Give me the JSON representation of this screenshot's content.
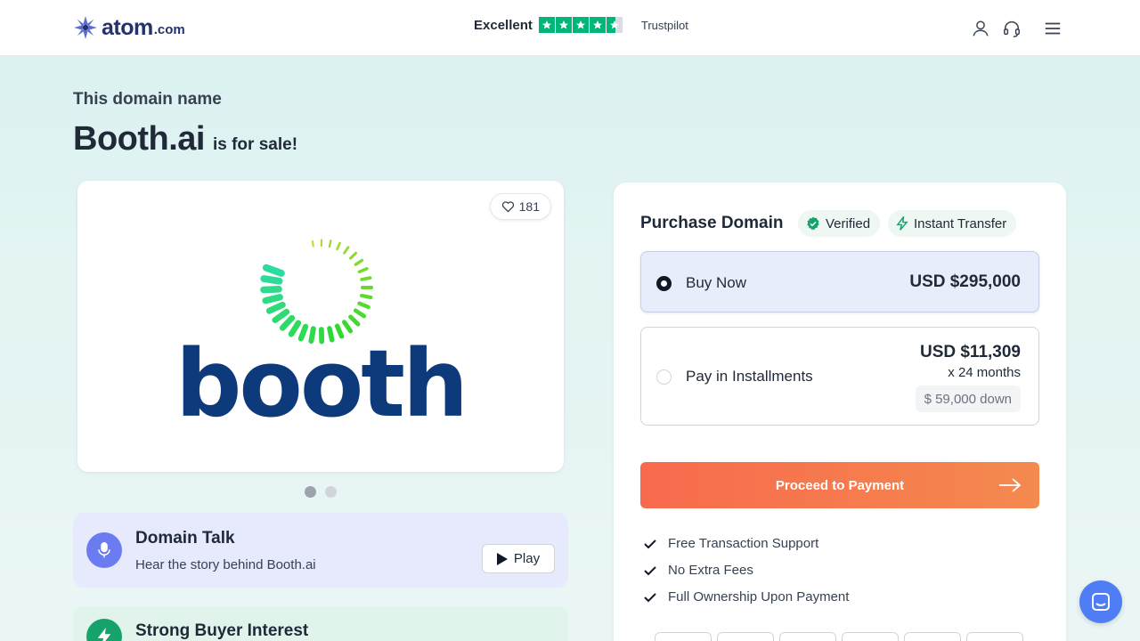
{
  "header": {
    "logo_word": "atom",
    "logo_tld": ".com",
    "trust_label": "Excellent",
    "trust_brand": "Trustpilot",
    "trust_rating_stars": 4.5,
    "icons": [
      "user-icon",
      "headset-icon",
      "menu-icon"
    ]
  },
  "hero": {
    "eyebrow": "This domain name",
    "domain": "Booth.ai",
    "for_sale": "is for sale!"
  },
  "logo_card": {
    "likes": "181",
    "logo_text": "booth",
    "slide_count": 2,
    "active_slide": 1
  },
  "domain_talk": {
    "title": "Domain Talk",
    "subtitle": "Hear the story behind Booth.ai",
    "play_label": "Play"
  },
  "interest": {
    "title": "Strong Buyer Interest"
  },
  "purchase": {
    "title": "Purchase Domain",
    "badge_verified": "Verified",
    "badge_transfer": "Instant Transfer",
    "buy_now_label": "Buy Now",
    "buy_now_price": "USD $295,000",
    "installments_label": "Pay in Installments",
    "installments_price": "USD $11,309",
    "installments_months": "x 24 months",
    "installments_down": "$ 59,000 down",
    "proceed_label": "Proceed to Payment",
    "features": [
      "Free Transaction Support",
      "No Extra Fees",
      "Full Ownership Upon Payment"
    ]
  },
  "colors": {
    "brand_navy": "#25316b",
    "trustpilot_green": "#00b67a",
    "cta_orange": "#f86a4d",
    "booth_blue": "#0d3a7a",
    "talk_purple": "#6b7cf0",
    "interest_green": "#16a36b",
    "chat_blue": "#4f7df5"
  }
}
